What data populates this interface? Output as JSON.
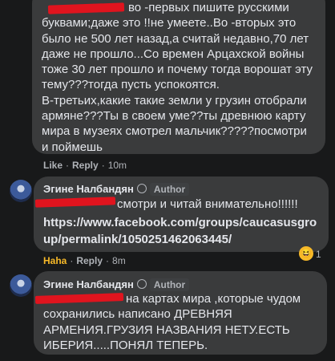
{
  "comment1": {
    "lines": [
      "во -первых пишите русскими",
      "буквами;даже это !!не умеете..Во -вторых это",
      "было не 500 лет назад,а считай недавно,70 лет",
      "даже не прошло...Со времен Арцахской войны",
      "тоже 30 лет прошло и почему тогда ворошат эту",
      "тему???тогда пусть успокоятся.",
      "В-третьих,какие такие земли у грузин отобрали",
      "армяне???Ты в своем уме??ты древнюю карту",
      "мира в музеях смотрел мальчик?????посмотри",
      "и поймешь"
    ],
    "actions": {
      "like": "Like",
      "reply": "Reply",
      "time": "10m"
    }
  },
  "comment2": {
    "author": "Эгине Налбандян",
    "badge": "Author",
    "text": "смотри и читай внимательно!!!!!!",
    "link_line1": "https://www.facebook.com/groups/caucasusgro",
    "link_line2": "up/permalink/1050251462063445/",
    "actions": {
      "like": "Haha",
      "reply": "Reply",
      "time": "8m"
    },
    "reaction_count": "1"
  },
  "comment3": {
    "author": "Эгине Налбандян",
    "badge": "Author",
    "lines": [
      "на картах мира ,которые чудом",
      "сохранились написано ДРЕВНЯЯ",
      "АРМЕНИЯ.ГРУЗИЯ НАЗВАНИЯ НЕТУ.ЕСТЬ",
      "ИБЕРИЯ.....ПОНЯЛ ТЕПЕРЬ."
    ]
  },
  "colors": {
    "haha": "#f7b928",
    "redact": "#e0141e"
  }
}
